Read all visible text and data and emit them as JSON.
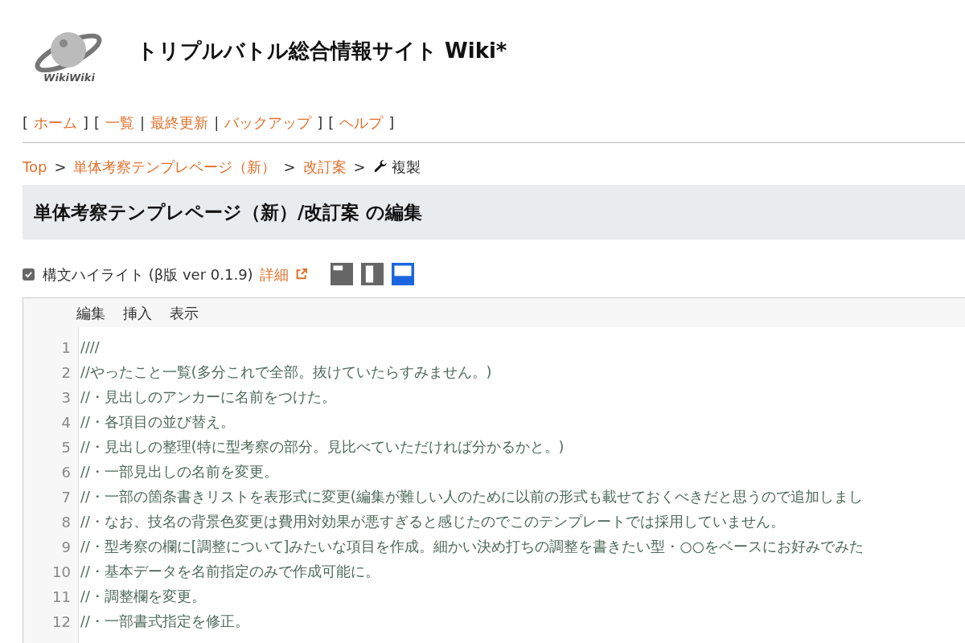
{
  "header": {
    "logo_text": "WikiWiki",
    "title": "トリプルバトル総合情報サイト Wiki*"
  },
  "nav": [
    {
      "kind": "open",
      "text": "["
    },
    {
      "kind": "link",
      "text": "ホーム"
    },
    {
      "kind": "close",
      "text": "]"
    },
    {
      "kind": "open",
      "text": "["
    },
    {
      "kind": "link",
      "text": "一覧"
    },
    {
      "kind": "sep",
      "text": "|"
    },
    {
      "kind": "link",
      "text": "最終更新"
    },
    {
      "kind": "sep",
      "text": "|"
    },
    {
      "kind": "link",
      "text": "バックアップ"
    },
    {
      "kind": "close",
      "text": "]"
    },
    {
      "kind": "open",
      "text": "["
    },
    {
      "kind": "link",
      "text": "ヘルプ"
    },
    {
      "kind": "close",
      "text": "]"
    }
  ],
  "breadcrumb": [
    {
      "kind": "link",
      "text": "Top"
    },
    {
      "kind": "sep",
      "text": ">"
    },
    {
      "kind": "link",
      "text": "単体考察テンプレページ（新）"
    },
    {
      "kind": "sep",
      "text": ">"
    },
    {
      "kind": "link",
      "text": "改訂案"
    },
    {
      "kind": "sep",
      "text": ">"
    },
    {
      "kind": "current",
      "text": "複製"
    }
  ],
  "page_heading": "単体考察テンプレページ（新）/改訂案 の編集",
  "syntax_highlight": {
    "checked": true,
    "label": "構文ハイライト (β版 ver 0.1.9)",
    "details_link": "詳細"
  },
  "layout_buttons": [
    {
      "kind": "top-left",
      "selected": false
    },
    {
      "kind": "right",
      "selected": false
    },
    {
      "kind": "bottom",
      "selected": true
    }
  ],
  "editor_menu": [
    "編集",
    "挿入",
    "表示"
  ],
  "editor_lines": [
    {
      "number": "1",
      "text": "////"
    },
    {
      "number": "2",
      "text": "//やったこと一覧(多分これで全部。抜けていたらすみません。)"
    },
    {
      "number": "3",
      "text": "//・見出しのアンカーに名前をつけた。"
    },
    {
      "number": "4",
      "text": "//・各項目の並び替え。"
    },
    {
      "number": "5",
      "text": "//・見出しの整理(特に型考察の部分。見比べていただければ分かるかと。)"
    },
    {
      "number": "6",
      "text": "//・一部見出しの名前を変更。"
    },
    {
      "number": "7",
      "text": "//・一部の箇条書きリストを表形式に変更(編集が難しい人のために以前の形式も載せておくべきだと思うので追加しまし"
    },
    {
      "number": "8",
      "text": "//・なお、技名の背景色変更は費用対効果が悪すぎると感じたのでこのテンプレートでは採用していません。"
    },
    {
      "number": "9",
      "text": "//・型考察の欄に[調整について]みたいな項目を作成。細かい決め打ちの調整を書きたい型・○○をベースにお好みでみた"
    },
    {
      "number": "10",
      "text": "//・基本データを名前指定のみで作成可能に。"
    },
    {
      "number": "11",
      "text": "//・調整欄を変更。"
    },
    {
      "number": "12",
      "text": "//・一部書式指定を修正。"
    }
  ]
}
